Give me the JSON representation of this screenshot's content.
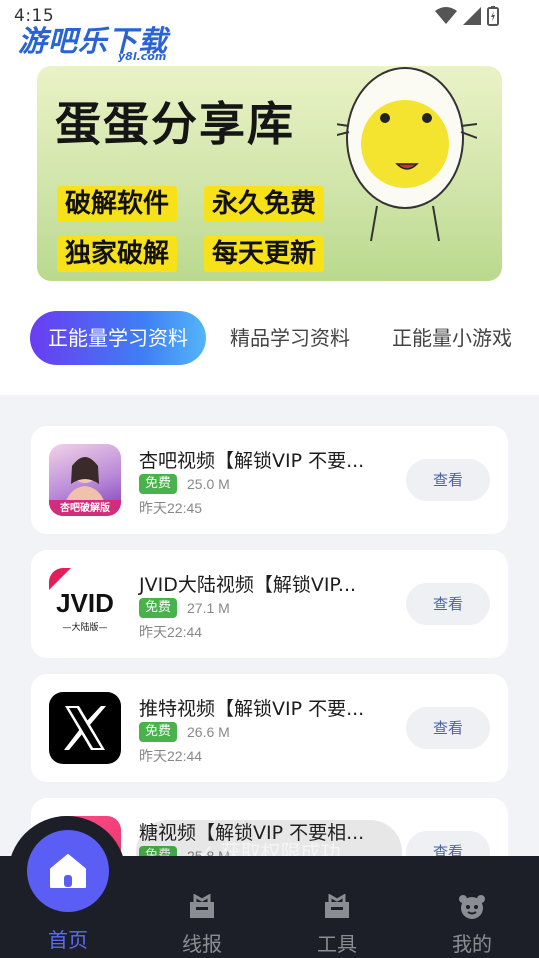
{
  "status_bar": {
    "time": "4:15"
  },
  "watermark": {
    "main": "游吧乐下载",
    "sub": "y8l.com"
  },
  "banner": {
    "title": "蛋蛋分享库",
    "tags": [
      "破解软件",
      "永久免费",
      "独家破解",
      "每天更新"
    ]
  },
  "tabs": [
    {
      "label": "正能量学习资料",
      "active": true
    },
    {
      "label": "精品学习资料",
      "active": false
    },
    {
      "label": "正能量小游戏",
      "active": false
    }
  ],
  "apps": [
    {
      "title": "杏吧视频【解锁VIP 不要...",
      "badge": "免费",
      "size": "25.0 M",
      "date": "昨天22:45",
      "button": "查看",
      "icon_text": "杏吧破解版",
      "icon_name": "xingba-app-icon"
    },
    {
      "title": "JVID大陆视频【解锁VIP...",
      "badge": "免费",
      "size": "27.1 M",
      "date": "昨天22:44",
      "button": "查看",
      "icon_text": "JVID",
      "icon_sub": "—大陆版—",
      "icon_name": "jvid-app-icon"
    },
    {
      "title": "推特视频【解锁VIP 不要...",
      "badge": "免费",
      "size": "26.6 M",
      "date": "昨天22:44",
      "button": "查看",
      "icon_name": "x-app-icon"
    },
    {
      "title": "糖视频【解锁VIP 不要相...",
      "badge": "免费",
      "size": "25.8 M",
      "date": "",
      "button": "查看",
      "icon_name": "tang-app-icon"
    }
  ],
  "toast": {
    "text": "获取权限成功"
  },
  "bottom_nav": [
    {
      "label": "首页",
      "icon": "home-icon",
      "active": true
    },
    {
      "label": "线报",
      "icon": "briefcase-icon",
      "active": false
    },
    {
      "label": "工具",
      "icon": "toolbox-icon",
      "active": false
    },
    {
      "label": "我的",
      "icon": "profile-icon",
      "active": false
    }
  ],
  "colors": {
    "accent": "#5a5ef5",
    "badge_green": "#47b34a",
    "tag_yellow": "#f7e21a",
    "nav_bg": "#1d1f28"
  }
}
